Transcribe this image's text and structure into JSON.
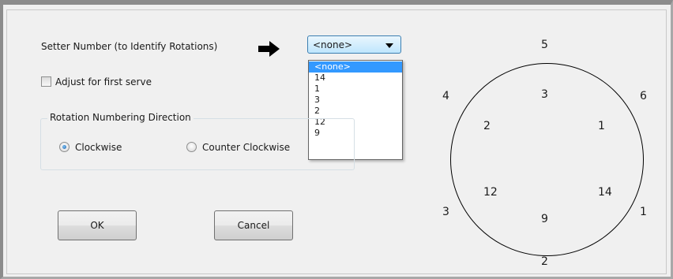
{
  "setter": {
    "label": "Setter Number (to Identify Rotations)",
    "selected": "<none>",
    "options": [
      "<none>",
      "14",
      "1",
      "3",
      "2",
      "12",
      "9"
    ]
  },
  "adjust_first_serve": {
    "label": "Adjust for first serve",
    "checked": false
  },
  "rotation_direction": {
    "title": "Rotation Numbering Direction",
    "options": [
      {
        "label": "Clockwise",
        "selected": true
      },
      {
        "label": "Counter Clockwise",
        "selected": false
      }
    ]
  },
  "buttons": {
    "ok": "OK",
    "cancel": "Cancel"
  },
  "court": {
    "outer": {
      "top": "5",
      "upper_right": "6",
      "lower_right": "1",
      "bottom": "2",
      "lower_left": "3",
      "upper_left": "4"
    },
    "inner": {
      "top": "3",
      "upper_right": "1",
      "lower_right": "14",
      "bottom": "9",
      "lower_left": "12",
      "upper_left": "2"
    }
  }
}
